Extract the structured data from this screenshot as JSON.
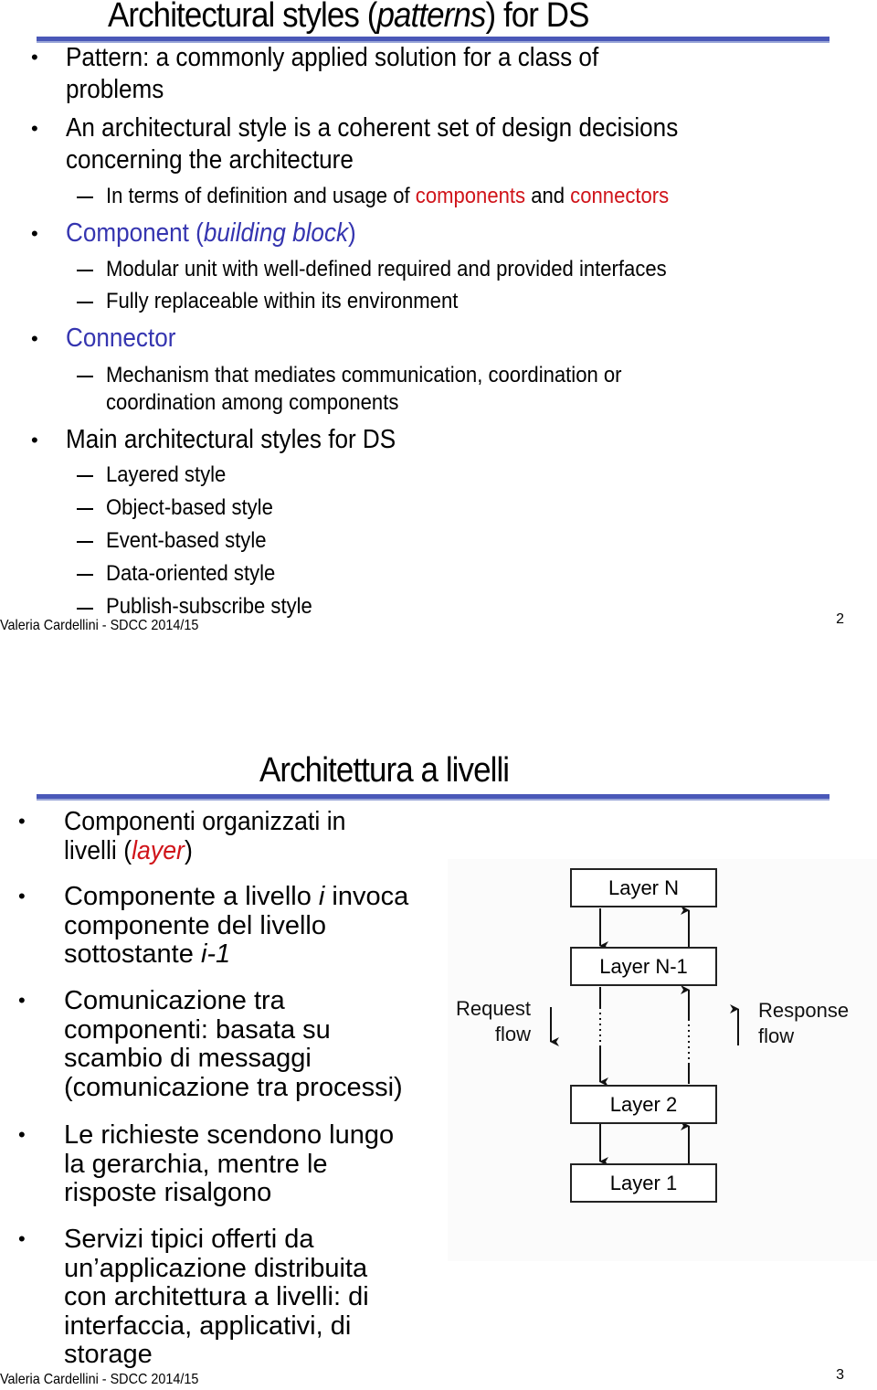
{
  "slide1": {
    "title_prefix": "Architectural styles (",
    "title_italic": "patterns",
    "title_suffix": ") for DS",
    "bullets": [
      {
        "line1": "Pattern: a commonly applied solution for a class of",
        "line2": "problems"
      },
      {
        "line1": "An architectural style is a coherent set of design decisions",
        "line2": "concerning the architecture",
        "sub": [
          {
            "prefix": "In terms of definition and usage of ",
            "red1": "components",
            "mid": " and ",
            "red2": "connectors"
          }
        ]
      },
      {
        "prefix": "Component (",
        "italic": "building block",
        "suffix": ")",
        "sub": [
          "Modular unit with well-defined required and provided interfaces",
          "Fully replaceable within its environment"
        ]
      },
      {
        "text": "Connector",
        "sub": [
          {
            "line1": "Mechanism that mediates communication, coordination or",
            "line2": "coordination among components"
          }
        ]
      },
      {
        "text": "Main architectural styles for DS",
        "sub": [
          "Layered style",
          "Object-based style",
          "Event-based style",
          "Data-oriented style",
          "Publish-subscribe style"
        ]
      }
    ],
    "footer": "Valeria Cardellini - SDCC 2014/15",
    "page_number": "2"
  },
  "slide2": {
    "title": "Architettura a livelli",
    "bullets": [
      {
        "line1": "Componenti organizzati in",
        "line2_prefix": "livelli (",
        "line2_italic": "layer",
        "line2_suffix": ")"
      },
      {
        "line1_prefix": "Componente a livello ",
        "line1_italic": "i",
        "line1_suffix": " invoca",
        "line2": "componente del livello",
        "line3_prefix": "sottostante ",
        "line3_italic": "i-1"
      },
      {
        "lines": [
          "Comunicazione tra",
          "componenti: basata su",
          "scambio di messaggi",
          "(comunicazione tra processi)"
        ]
      },
      {
        "lines": [
          "Le richieste scendono lungo",
          "la gerarchia, mentre le",
          "risposte risalgono"
        ]
      },
      {
        "lines": [
          "Servizi tipici offerti da",
          "un’applicazione distribuita",
          "con architettura a livelli: di",
          "interfaccia, applicativi, di",
          "storage"
        ]
      }
    ],
    "diagram": {
      "layers": [
        "Layer N",
        "Layer N-1",
        "Layer 2",
        "Layer 1"
      ],
      "request_flow": [
        "Request",
        "flow"
      ],
      "response_flow": [
        "Response",
        "flow"
      ]
    },
    "footer": "Valeria Cardellini - SDCC 2014/15",
    "page_number": "3"
  },
  "colors": {
    "rule": "#4a58b8",
    "accent_blue": "#3535b0",
    "accent_red": "#d0141a"
  }
}
